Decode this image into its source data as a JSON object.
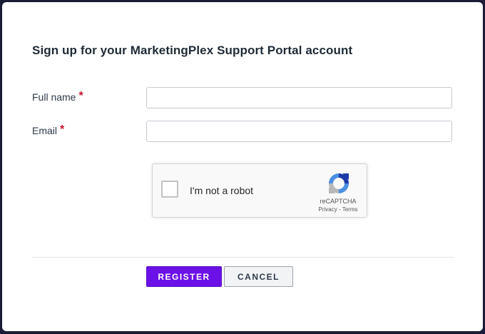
{
  "dialog": {
    "title": "Sign up for your MarketingPlex Support Portal account"
  },
  "form": {
    "full_name": {
      "label": "Full name",
      "required_marker": "*",
      "value": ""
    },
    "email": {
      "label": "Email",
      "required_marker": "*",
      "value": ""
    }
  },
  "recaptcha": {
    "checkbox_label": "I'm not a robot",
    "brand": "reCAPTCHA",
    "privacy_label": "Privacy",
    "separator": " - ",
    "terms_label": "Terms",
    "checked": false,
    "logo_icon": "recaptcha-logo-icon"
  },
  "buttons": {
    "register_label": "REGISTER",
    "cancel_label": "CANCEL"
  },
  "colors": {
    "accent": "#6c10e8",
    "required": "#c8102e",
    "background": "#1b1d36"
  }
}
